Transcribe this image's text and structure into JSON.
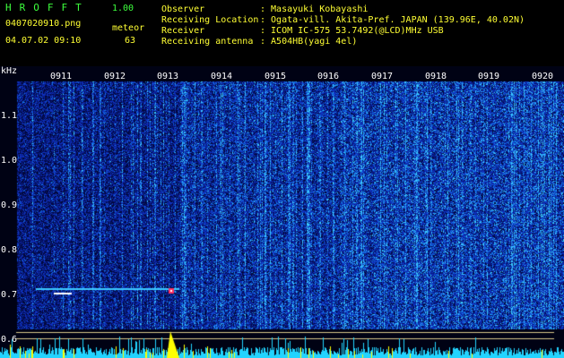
{
  "header": {
    "app_title": "HROFFT",
    "version": "1.00",
    "filename": "0407020910.png",
    "datetime": "04.07.02 09:10",
    "meteor_label": "meteor",
    "meteor_count": "63",
    "info": [
      {
        "label": "Observer",
        "value": ": Masayuki Kobayashi"
      },
      {
        "label": "Receiving Location",
        "value": ": Ogata-vill. Akita-Pref. JAPAN (139.96E, 40.02N)"
      },
      {
        "label": "Receiver",
        "value": ": ICOM IC-575 53.7492(@LCD)MHz USB"
      },
      {
        "label": "Receiving antenna",
        "value": ": A504HB(yagi 4el)"
      }
    ]
  },
  "spectrogram": {
    "y_unit": "kHz",
    "y_ticks": [
      "1.1",
      "1.0",
      "0.9",
      "0.8",
      "0.7",
      "0.6"
    ],
    "x_ticks": [
      "0911",
      "0912",
      "0913",
      "0914",
      "0915",
      "0916",
      "0917",
      "0918",
      "0919",
      "0920"
    ],
    "colors": {
      "background": "#00001a",
      "noise_low": "#0a1a8c",
      "noise_high": "#3cc8ff",
      "signal": "#ffff00",
      "hot": "#ff3060",
      "grid_line": "#d8c88a"
    }
  }
}
